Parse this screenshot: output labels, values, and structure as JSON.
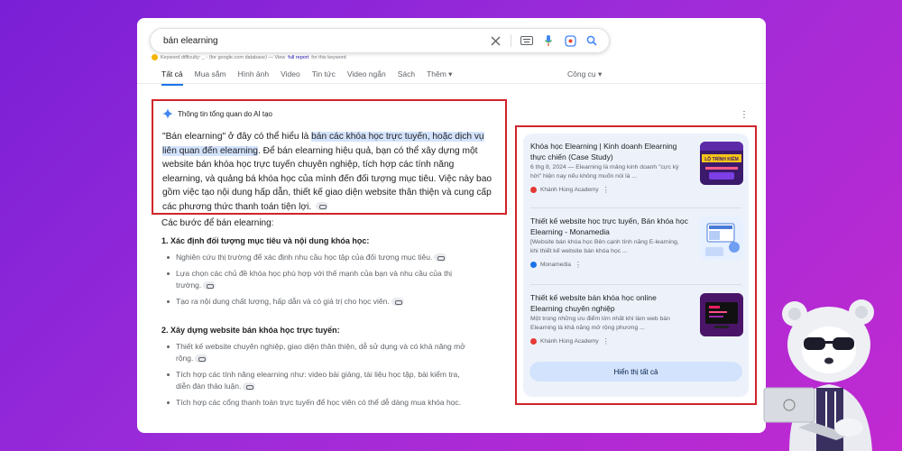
{
  "search": {
    "query": "bán elearning",
    "keyword_difficulty": "Keyword difficulty: _ - (for google.com database) — View",
    "kw_link": "full report",
    "kw_suffix": "for this keyword"
  },
  "tabs": [
    "Tất cả",
    "Mua sắm",
    "Hình ảnh",
    "Video",
    "Tin tức",
    "Video ngắn",
    "Sách",
    "Thêm ▾"
  ],
  "tools_label": "Công cụ ▾",
  "ai_overview": {
    "header": "Thông tin tổng quan do AI tạo",
    "p1": "\"Bán elearning\" ở đây có thể hiểu là ",
    "p1_highlight": "bán các khóa học trực tuyến, hoặc dịch vụ liên quan đến elearning",
    "p1_rest": ". Để bán elearning hiệu quả, bạn có thể xây dựng một website bán khóa học trực tuyến chuyên nghiệp, tích hợp các tính năng elearning, và quảng bá khóa học của mình đến đối tượng mục tiêu. Việc này bao gồm việc tạo nội dung hấp dẫn, thiết kế giao diện website thân thiện và cung cấp các phương thức thanh toán tiện lợi."
  },
  "steps": {
    "title": "Các bước để bán elearning:",
    "sections": [
      {
        "heading": "1. Xác định đối tượng mục tiêu và nội dung khóa học:",
        "bullets": [
          "Nghiên cứu thị trường để xác định nhu cầu học tập của đối tượng mục tiêu.",
          "Lựa chọn các chủ đề khóa học phù hợp với thế mạnh của bạn và nhu cầu của thị trường.",
          "Tạo ra nội dung chất lượng, hấp dẫn và có giá trị cho học viên."
        ]
      },
      {
        "heading": "2. Xây dựng website bán khóa học trực tuyến:",
        "bullets": [
          "Thiết kế website chuyên nghiệp, giao diện thân thiện, dễ sử dụng và có khả năng mở rộng.",
          "Tích hợp các tính năng elearning như: video bài giảng, tài liệu học tập, bài kiểm tra, diễn đàn thảo luận.",
          "Tích hợp các cổng thanh toán trực tuyến để học viên có thể dễ dàng mua khóa học."
        ]
      }
    ]
  },
  "sources": [
    {
      "title": "Khóa học Elearning | Kinh doanh Elearning thực chiến (Case Study)",
      "snippet": "6 thg 8, 2024 — Elearning là mảng kinh doanh \"cực kỳ hời\" hiện nay nếu không muốn nói là ...",
      "site": "Khánh Hùng Academy",
      "thumb_text": "LỘ TRÌNH KIẾM"
    },
    {
      "title": "Thiết kế website học trực tuyến, Bán khóa học Elearning - Monamedia",
      "snippet": "[Website bán khóa học Bên cạnh tính năng E-learning, khi thiết kế website bán khóa học ...",
      "site": "Monamedia",
      "thumb_text": ""
    },
    {
      "title": "Thiết kế website bán khóa học online Elearning chuyên nghiệp",
      "snippet": "Một trong những ưu điểm lớn nhất khi làm web bán Elearning là khả năng mở rộng phương ...",
      "site": "Khánh Hùng Academy",
      "thumb_text": ""
    }
  ],
  "show_all_label": "Hiển thị tất cả",
  "colors": {
    "highlight_box": "#d0242b",
    "accent": "#1a73e8",
    "source_panel": "#edf2fa"
  }
}
